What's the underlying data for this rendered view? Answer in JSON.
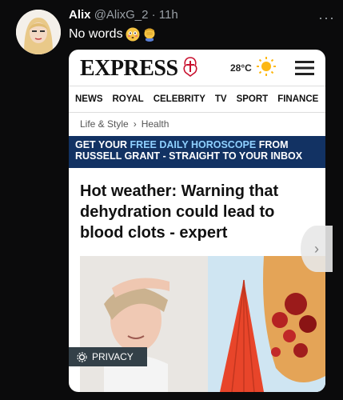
{
  "tweet": {
    "name": "Alix",
    "handle": "@AlixG_2",
    "time": "11h",
    "more": "···",
    "text": "No words",
    "emoji": [
      "flushed-face-emoji",
      "facepalm-emoji"
    ]
  },
  "card": {
    "logo": "EXPRESS",
    "temperature": "28°C",
    "nav": [
      "NEWS",
      "ROYAL",
      "CELEBRITY",
      "TV",
      "SPORT",
      "FINANCE"
    ],
    "breadcrumb": [
      "Life & Style",
      "Health"
    ],
    "banner_line1_a": "GET YOUR",
    "banner_line1_b": "FREE DAILY HOROSCOPE",
    "banner_line1_c": "FROM",
    "banner_line2": "RUSSELL GRANT - STRAIGHT TO YOUR INBOX",
    "headline": "Hot weather: Warning that dehydration could lead to blood clots - expert",
    "privacy_label": "PRIVACY"
  }
}
